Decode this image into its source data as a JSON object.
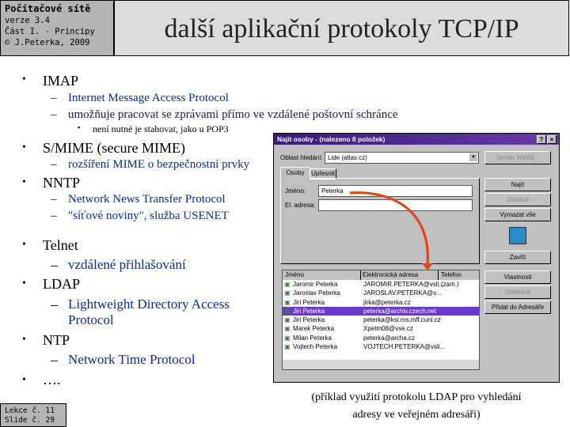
{
  "header": {
    "course": "Počítačové sítě",
    "version": "verze 3.4",
    "part": "Část I. - Principy",
    "copyright": "© J.Peterka, 2009",
    "title": "další aplikační  protokoly TCP/IP"
  },
  "bullets": [
    {
      "label": "IMAP",
      "subs": [
        {
          "text": "Internet Message Access Protocol"
        },
        {
          "text": "umožňuje pracovat se zprávami přímo ve vzdálené poštovní schránce",
          "subsub": "není nutné je stahovat, jako u POP3"
        }
      ]
    },
    {
      "label": "S/MIME (secure MIME)",
      "subs": [
        {
          "text": "rozšíření MIME o bezpečnostní prvky"
        }
      ]
    },
    {
      "label": "NNTP",
      "subs": [
        {
          "text": "Network News Transfer Protocol"
        },
        {
          "text": "\"síťové noviny\", služba USENET"
        }
      ]
    },
    {
      "label": "Telnet",
      "subs": [
        {
          "text": "vzdálené přihlašování"
        }
      ]
    },
    {
      "label": "LDAP",
      "subs": [
        {
          "text": "Lightweight Directory Access Protocol"
        }
      ]
    },
    {
      "label": "NTP",
      "subs": [
        {
          "text": "Network Time Protocol"
        }
      ]
    },
    {
      "label": "…."
    }
  ],
  "dialog": {
    "title": "Najít osoby - (nalezeno 8 položek)",
    "help": "?",
    "close": "×",
    "search_area_label": "Oblast hledání:",
    "search_area_value": "Lide (atlas.cz)",
    "tabs": [
      "Osoby",
      "Upřesnit"
    ],
    "name_label": "Jméno:",
    "name_value": "Peterka",
    "email_label": "El. adresa:",
    "email_value": "",
    "buttons": {
      "server": "Server WWW...",
      "find": "Najít",
      "stop": "Zastavit",
      "clear": "Vymazat vše",
      "close": "Zavřít",
      "properties": "Vlastnosti",
      "remove": "Odstranit",
      "add": "Přidat do Adresáře"
    },
    "columns": [
      "Jméno",
      "Elektronická adresa",
      "Telefon (zam.)"
    ],
    "rows": [
      [
        "Jaromir Peterka",
        "JAROMIR.PETERKA@vsli..."
      ],
      [
        "Jaroslav Peterka",
        "JAROSLAV.PETERKA@v..."
      ],
      [
        "Jiri Peterka",
        "jirka@peterka.cz"
      ],
      [
        "Jiri Peterka",
        "peterka@archiv.czech.net"
      ],
      [
        "Jiri Peterka",
        "peterka@ksi.ms.mff.cuni.cz"
      ],
      [
        "Marek Peterka",
        "Xpetm08@vse.cz"
      ],
      [
        "Milan Peterka",
        "peterka@archa.cz"
      ],
      [
        "Vojtech Peterka",
        "VOJTECH.PETERKA@vsli..."
      ]
    ],
    "selected_row": 3
  },
  "caption": {
    "line1": "(příklad využití protokolu LDAP pro vyhledání",
    "line2": "adresy ve veřejném   adresáři)"
  },
  "footer": {
    "lesson": "Lekce č. 11",
    "slide": "Slide č. 29"
  },
  "colors": {
    "accent_text": "#0a2a9a",
    "arrow": "#e84010",
    "selection": "#6a3ad0"
  }
}
